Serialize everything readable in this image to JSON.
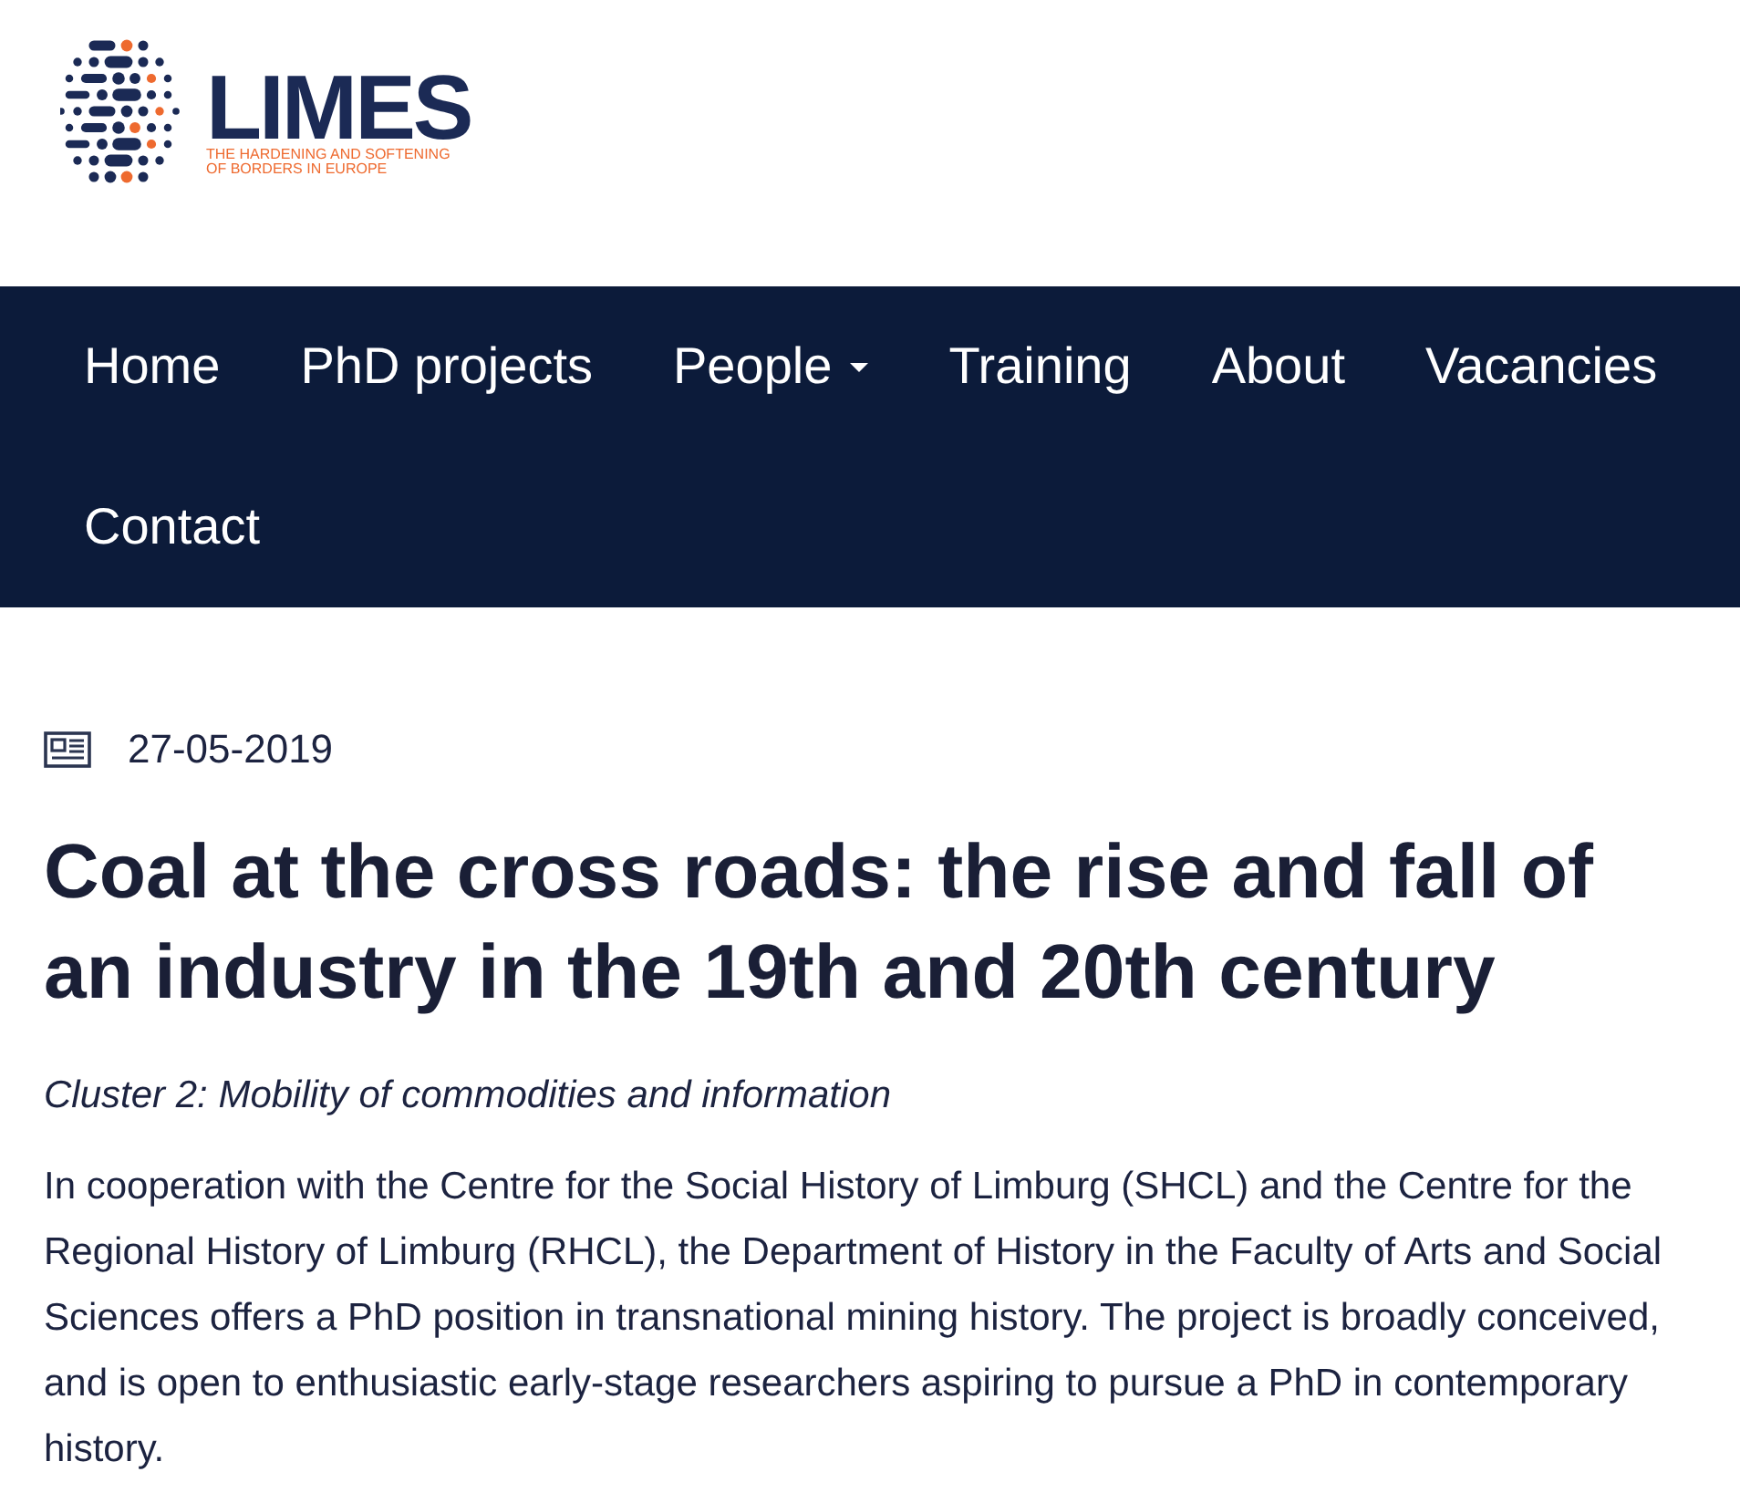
{
  "header": {
    "logo": {
      "name": "LIMES",
      "tagline": [
        "THE HARDENING AND SOFTENING",
        "OF BORDERS IN EUROPE"
      ]
    }
  },
  "nav": {
    "items": [
      {
        "label": "Home",
        "dropdown": false
      },
      {
        "label": "PhD projects",
        "dropdown": false
      },
      {
        "label": "People",
        "dropdown": true
      },
      {
        "label": "Training",
        "dropdown": false
      },
      {
        "label": "About",
        "dropdown": false
      },
      {
        "label": "Vacancies",
        "dropdown": false
      },
      {
        "label": "Contact",
        "dropdown": false
      }
    ]
  },
  "article": {
    "date": "27-05-2019",
    "title": "Coal at the cross roads: the rise and fall of an industry in the 19th and 20th century",
    "subtitle": "Cluster 2: Mobility of commodities and information",
    "body": "In cooperation with the Centre for the Social History of Limburg (SHCL) and the Centre for the Regional History of Limburg (RHCL), the Department of History in the Faculty of Arts and Social Sciences offers a PhD position in transnational mining history. The project is broadly conceived, and is open to enthusiastic early-stage researchers aspiring to pursue a PhD in contemporary history."
  }
}
